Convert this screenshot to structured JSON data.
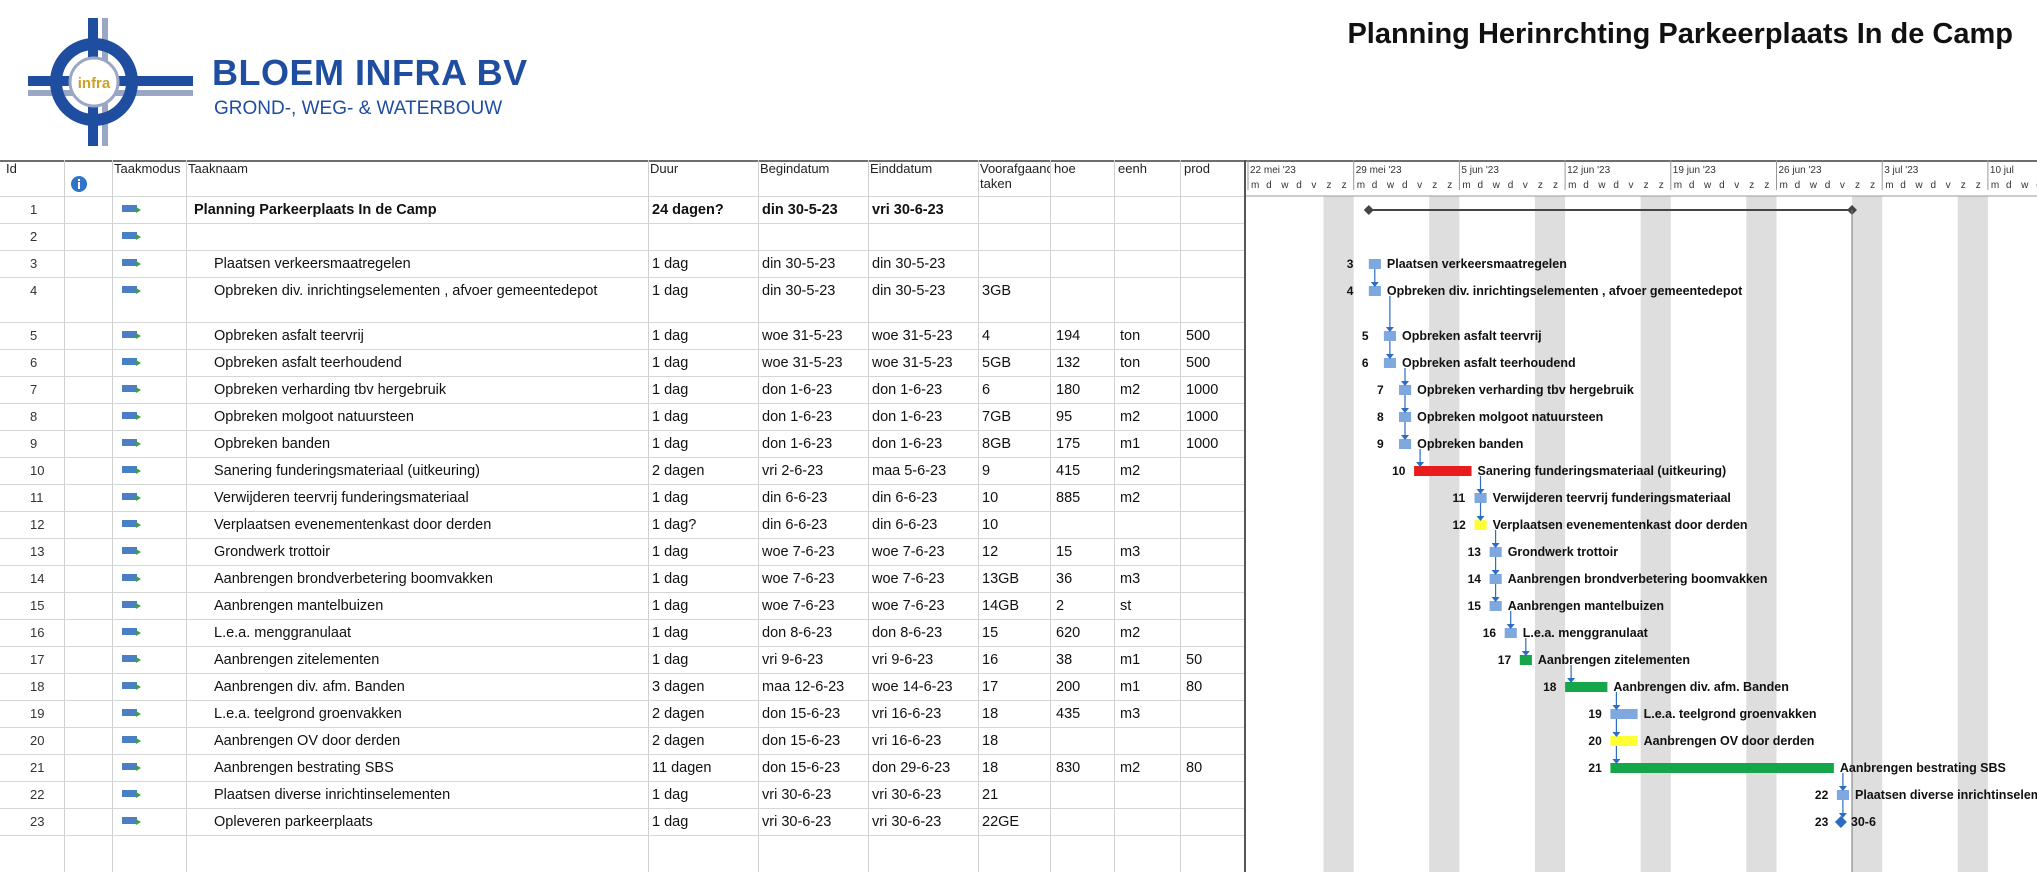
{
  "header": {
    "company_name": "BLOEM INFRA BV",
    "tagline": "GROND-, WEG- & WATERBOUW",
    "logo_text": "infra",
    "title": "Planning Herinrchting Parkeerplaats In de Camp"
  },
  "columns": {
    "id": "Id",
    "mode": "Taakmodus",
    "name": "Taaknaam",
    "duration": "Duur",
    "start": "Begindatum",
    "finish": "Einddatum",
    "predecessors": "Voorafgaande taken",
    "qty": "hoe",
    "unit": "eenh",
    "prod": "prod"
  },
  "tasks": [
    {
      "id": "1",
      "name": "Planning Parkeerplaats In de Camp",
      "duration": "24 dagen?",
      "start": "din 30-5-23",
      "finish": "vri 30-6-23",
      "pred": "",
      "qty": "",
      "unit": "",
      "prod": ""
    },
    {
      "id": "2",
      "name": "",
      "duration": "",
      "start": "",
      "finish": "",
      "pred": "",
      "qty": "",
      "unit": "",
      "prod": ""
    },
    {
      "id": "3",
      "name": "Plaatsen verkeersmaatregelen",
      "duration": "1 dag",
      "start": "din 30-5-23",
      "finish": "din 30-5-23",
      "pred": "",
      "qty": "",
      "unit": "",
      "prod": ""
    },
    {
      "id": "4",
      "name": "Opbreken div. inrichtingselementen , afvoer gemeentedepot",
      "duration": "1 dag",
      "start": "din 30-5-23",
      "finish": "din 30-5-23",
      "pred": "3GB",
      "qty": "",
      "unit": "",
      "prod": ""
    },
    {
      "id": "5",
      "name": "Opbreken asfalt teervrij",
      "duration": "1 dag",
      "start": "woe 31-5-23",
      "finish": "woe 31-5-23",
      "pred": "4",
      "qty": "194",
      "unit": "ton",
      "prod": "500"
    },
    {
      "id": "6",
      "name": "Opbreken asfalt teerhoudend",
      "duration": "1 dag",
      "start": "woe 31-5-23",
      "finish": "woe 31-5-23",
      "pred": "5GB",
      "qty": "132",
      "unit": "ton",
      "prod": "500"
    },
    {
      "id": "7",
      "name": "Opbreken verharding tbv hergebruik",
      "duration": "1 dag",
      "start": "don 1-6-23",
      "finish": "don 1-6-23",
      "pred": "6",
      "qty": "180",
      "unit": "m2",
      "prod": "1000"
    },
    {
      "id": "8",
      "name": "Opbreken molgoot natuursteen",
      "duration": "1 dag",
      "start": "don 1-6-23",
      "finish": "don 1-6-23",
      "pred": "7GB",
      "qty": "95",
      "unit": "m2",
      "prod": "1000"
    },
    {
      "id": "9",
      "name": "Opbreken banden",
      "duration": "1 dag",
      "start": "don 1-6-23",
      "finish": "don 1-6-23",
      "pred": "8GB",
      "qty": "175",
      "unit": "m1",
      "prod": "1000"
    },
    {
      "id": "10",
      "name": "Sanering funderingsmateriaal (uitkeuring)",
      "duration": "2 dagen",
      "start": "vri 2-6-23",
      "finish": "maa 5-6-23",
      "pred": "9",
      "qty": "415",
      "unit": "m2",
      "prod": ""
    },
    {
      "id": "11",
      "name": "Verwijderen teervrij funderingsmateriaal",
      "duration": "1 dag",
      "start": "din 6-6-23",
      "finish": "din 6-6-23",
      "pred": "10",
      "qty": "885",
      "unit": "m2",
      "prod": ""
    },
    {
      "id": "12",
      "name": "Verplaatsen evenementenkast door derden",
      "duration": "1 dag?",
      "start": "din 6-6-23",
      "finish": "din 6-6-23",
      "pred": "10",
      "qty": "",
      "unit": "",
      "prod": ""
    },
    {
      "id": "13",
      "name": "Grondwerk trottoir",
      "duration": "1 dag",
      "start": "woe 7-6-23",
      "finish": "woe 7-6-23",
      "pred": "12",
      "qty": "15",
      "unit": "m3",
      "prod": ""
    },
    {
      "id": "14",
      "name": "Aanbrengen brondverbetering boomvakken",
      "duration": "1 dag",
      "start": "woe 7-6-23",
      "finish": "woe 7-6-23",
      "pred": "13GB",
      "qty": "36",
      "unit": "m3",
      "prod": ""
    },
    {
      "id": "15",
      "name": "Aanbrengen mantelbuizen",
      "duration": "1 dag",
      "start": "woe 7-6-23",
      "finish": "woe 7-6-23",
      "pred": "14GB",
      "qty": "2",
      "unit": "st",
      "prod": ""
    },
    {
      "id": "16",
      "name": "L.e.a. menggranulaat",
      "duration": "1 dag",
      "start": "don 8-6-23",
      "finish": "don 8-6-23",
      "pred": "15",
      "qty": "620",
      "unit": "m2",
      "prod": ""
    },
    {
      "id": "17",
      "name": "Aanbrengen zitelementen",
      "duration": "1 dag",
      "start": "vri 9-6-23",
      "finish": "vri 9-6-23",
      "pred": "16",
      "qty": "38",
      "unit": "m1",
      "prod": "50"
    },
    {
      "id": "18",
      "name": "Aanbrengen div. afm. Banden",
      "duration": "3 dagen",
      "start": "maa 12-6-23",
      "finish": "woe 14-6-23",
      "pred": "17",
      "qty": "200",
      "unit": "m1",
      "prod": "80"
    },
    {
      "id": "19",
      "name": "L.e.a. teelgrond groenvakken",
      "duration": "2 dagen",
      "start": "don 15-6-23",
      "finish": "vri 16-6-23",
      "pred": "18",
      "qty": "435",
      "unit": "m3",
      "prod": ""
    },
    {
      "id": "20",
      "name": "Aanbrengen OV door derden",
      "duration": "2 dagen",
      "start": "don 15-6-23",
      "finish": "vri 16-6-23",
      "pred": "18",
      "qty": "",
      "unit": "",
      "prod": ""
    },
    {
      "id": "21",
      "name": "Aanbrengen bestrating SBS",
      "duration": "11 dagen",
      "start": "don 15-6-23",
      "finish": "don 29-6-23",
      "pred": "18",
      "qty": "830",
      "unit": "m2",
      "prod": "80"
    },
    {
      "id": "22",
      "name": "Plaatsen diverse inrichtinselementen",
      "duration": "1 dag",
      "start": "vri 30-6-23",
      "finish": "vri 30-6-23",
      "pred": "21",
      "qty": "",
      "unit": "",
      "prod": ""
    },
    {
      "id": "23",
      "name": "Opleveren parkeerplaats",
      "duration": "1 dag",
      "start": "vri 30-6-23",
      "finish": "vri 30-6-23",
      "pred": "22GE",
      "qty": "",
      "unit": "",
      "prod": ""
    }
  ],
  "gantt": {
    "scale_start": "2023-05-22",
    "week_labels": [
      "22 mei '23",
      "29 mei '23",
      "5 jun '23",
      "12 jun '23",
      "19 jun '23",
      "26 jun '23",
      "3 jul '23",
      "10 jul"
    ],
    "day_letters": [
      "m",
      "d",
      "w",
      "d",
      "v",
      "z",
      "z"
    ],
    "bar_labels": {
      "3": "Plaatsen verkeersmaatregelen",
      "4": "Opbreken div. inrichtingselementen , afvoer gemeentedepot",
      "5": "Opbreken asfalt teervrij",
      "6": "Opbreken asfalt teerhoudend",
      "7": "Opbreken verharding tbv hergebruik",
      "8": "Opbreken molgoot natuursteen",
      "9": "Opbreken banden",
      "10": "Sanering funderingsmateriaal (uitkeuring)",
      "11": "Verwijderen teervrij funderingsmateriaal",
      "12": "Verplaatsen evenementenkast door derden",
      "13": "Grondwerk trottoir",
      "14": "Aanbrengen brondverbetering boomvakken",
      "15": "Aanbrengen mantelbuizen",
      "16": "L.e.a. menggranulaat",
      "17": "Aanbrengen zitelementen",
      "18": "Aanbrengen div. afm. Banden",
      "19": "L.e.a. teelgrond groenvakken",
      "20": "Aanbrengen OV door derden",
      "21": "Aanbrengen bestrating SBS",
      "22": "Plaatsen diverse inrichtinselementen",
      "23": "30-6"
    },
    "bar_colors": {
      "3": "#7fa8de",
      "4": "#7fa8de",
      "5": "#7fa8de",
      "6": "#7fa8de",
      "7": "#7fa8de",
      "8": "#7fa8de",
      "9": "#7fa8de",
      "10": "#e81c1c",
      "11": "#7fa8de",
      "12": "#ffff33",
      "13": "#7fa8de",
      "14": "#7fa8de",
      "15": "#7fa8de",
      "16": "#7fa8de",
      "17": "#16a64a",
      "18": "#16a64a",
      "19": "#7fa8de",
      "20": "#ffff33",
      "21": "#16a64a",
      "22": "#7fa8de"
    },
    "colors": {
      "summary": "#444444",
      "weekend_shade": "#dedede",
      "link": "#2b6cc4"
    }
  },
  "colors": {
    "brand_blue": "#1f4ea1",
    "grid_line": "#d6d6d6",
    "mode_icon": "#4a7fc5"
  }
}
